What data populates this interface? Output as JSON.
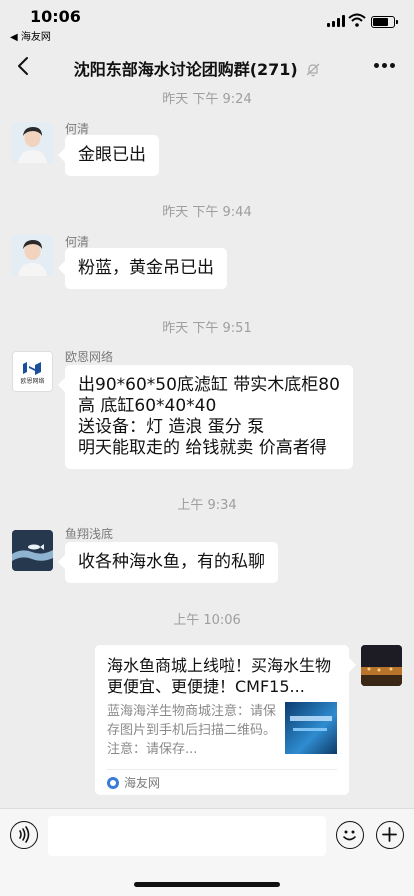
{
  "status_bar": {
    "time": "10:06",
    "back_app": "◀ 海友网"
  },
  "header": {
    "title": "沈阳东部海水讨论团购群(271)",
    "back_icon": "chevron-left-icon",
    "mute_icon": "bell-off-icon",
    "more_icon": "more-dots-icon"
  },
  "messages": [
    {
      "type": "timestamp",
      "text": "昨天 下午 9:24"
    },
    {
      "type": "text",
      "sender": "何清",
      "text": "金眼已出"
    },
    {
      "type": "timestamp",
      "text": "昨天 下午 9:44"
    },
    {
      "type": "text",
      "sender": "何清",
      "text": "粉蓝，黄金吊已出"
    },
    {
      "type": "timestamp",
      "text": "昨天 下午 9:51"
    },
    {
      "type": "text",
      "sender": "欧恩网络",
      "lines": [
        "出90*60*50底滤缸 带实木底柜80",
        "高 底缸60*40*40",
        "送设备：灯 造浪 蛋分 泵",
        "明天能取走的 给钱就卖 价高者得"
      ]
    },
    {
      "type": "timestamp",
      "text": "上午 9:34"
    },
    {
      "type": "text",
      "sender": "鱼翔浅底",
      "text": "收各种海水鱼，有的私聊"
    },
    {
      "type": "timestamp",
      "text": "上午 10:06"
    },
    {
      "type": "link_card",
      "title": "海水鱼商城上线啦！买海水生物更便宜、更便捷！CMF15...",
      "description": "蓝海海洋生物商城注意：请保存图片到手机后扫描二维码。注意：请保存...",
      "source": "海友网"
    }
  ],
  "avatars": {
    "heqing": "person-avatar",
    "ouen": "ouen-logo-avatar",
    "yuxiang": "fish-avatar",
    "self": "night-scene-avatar",
    "ouen_logo_text": "欧恩网络"
  },
  "input_bar": {
    "voice_icon": "voice-icon",
    "emoji_icon": "emoji-icon",
    "plus_icon": "plus-icon",
    "placeholder": ""
  }
}
